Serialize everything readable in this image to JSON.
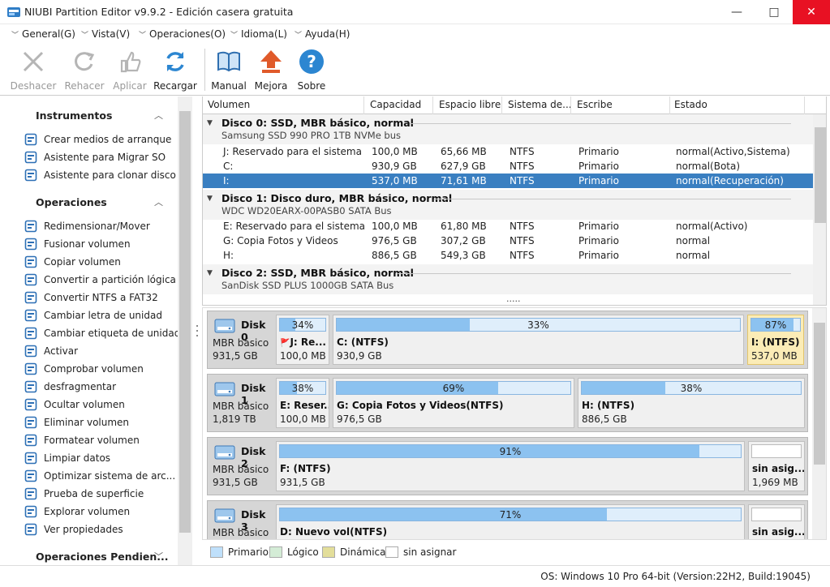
{
  "window": {
    "title": "NIUBI Partition Editor v9.9.2 - Edición casera gratuita",
    "minimize": "—",
    "maximize": "□",
    "close": "✕"
  },
  "menu": [
    {
      "label": "General(G)"
    },
    {
      "label": "Vista(V)"
    },
    {
      "label": "Operaciones(O)"
    },
    {
      "label": "Idioma(L)"
    },
    {
      "label": "Ayuda(H)"
    }
  ],
  "toolbar": {
    "undo": "Deshacer",
    "redo": "Rehacer",
    "apply": "Aplicar",
    "reload": "Recargar",
    "manual": "Manual",
    "upgrade": "Mejora",
    "about": "Sobre"
  },
  "sidebar": {
    "tools_title": "Instrumentos",
    "tools": [
      "Crear medios de arranque",
      "Asistente para Migrar SO",
      "Asistente para clonar disco"
    ],
    "ops_title": "Operaciones",
    "ops": [
      "Redimensionar/Mover",
      "Fusionar volumen",
      "Copiar volumen",
      "Convertir a partición lógica",
      "Convertir NTFS a FAT32",
      "Cambiar letra de unidad",
      "Cambiar etiqueta de unidad",
      "Activar",
      "Comprobar volumen",
      "desfragmentar",
      "Ocultar volumen",
      "Eliminar volumen",
      "Formatear volumen",
      "Limpiar datos",
      "Optimizar sistema de arc...",
      "Prueba de superficie",
      "Explorar volumen",
      "Ver propiedades"
    ],
    "pending_title": "Operaciones Pendien..."
  },
  "columns": [
    "Volumen",
    "Capacidad",
    "Espacio libre",
    "Sistema de...",
    "Escribe",
    "Estado"
  ],
  "disks": [
    {
      "title": "Disco 0: SSD, MBR básico, normal",
      "model": "Samsung SSD 990 PRO 1TB NVMe bus",
      "rows": [
        [
          "J: Reservado para el sistema",
          "100,0 MB",
          "65,66 MB",
          "NTFS",
          "Primario",
          "normal(Activo,Sistema)"
        ],
        [
          "C:",
          "930,9 GB",
          "627,9 GB",
          "NTFS",
          "Primario",
          "normal(Bota)"
        ],
        [
          "I:",
          "537,0 MB",
          "71,61 MB",
          "NTFS",
          "Primario",
          "normal(Recuperación)"
        ]
      ]
    },
    {
      "title": "Disco 1: Disco duro, MBR básico, normal",
      "model": "WDC WD20EARX-00PASB0 SATA Bus",
      "rows": [
        [
          "E: Reservado para el sistema",
          "100,0 MB",
          "61,80 MB",
          "NTFS",
          "Primario",
          "normal(Activo)"
        ],
        [
          "G: Copia Fotos y Videos",
          "976,5 GB",
          "307,2 GB",
          "NTFS",
          "Primario",
          "normal"
        ],
        [
          "H:",
          "886,5 GB",
          "549,3 GB",
          "NTFS",
          "Primario",
          "normal"
        ]
      ]
    },
    {
      "title": "Disco 2: SSD, MBR básico, normal",
      "model": "SanDisk SSD PLUS 1000GB SATA Bus"
    }
  ],
  "more_dots": ".....",
  "diskmap": [
    {
      "name": "Disk 0",
      "type": "MBR básico",
      "size": "931,5 GB",
      "parts": [
        {
          "pct": "34%",
          "fill": 0.34,
          "label": "J: Re...",
          "size": "100,0 MB",
          "flag": true
        },
        {
          "pct": "33%",
          "fill": 0.33,
          "label": "C: (NTFS)",
          "size": "930,9 GB"
        },
        {
          "pct": "87%",
          "fill": 0.87,
          "label": "I: (NTFS)",
          "size": "537,0 MB",
          "selected": true
        }
      ]
    },
    {
      "name": "Disk 1",
      "type": "MBR básico",
      "size": "1,819 TB",
      "parts": [
        {
          "pct": "38%",
          "fill": 0.38,
          "label": "E: Reser...",
          "size": "100,0 MB"
        },
        {
          "pct": "69%",
          "fill": 0.69,
          "label": "G: Copia Fotos y Videos(NTFS)",
          "size": "976,5 GB"
        },
        {
          "pct": "38%",
          "fill": 0.38,
          "label": "H: (NTFS)",
          "size": "886,5 GB"
        }
      ]
    },
    {
      "name": "Disk 2",
      "type": "MBR básico",
      "size": "931,5 GB",
      "parts": [
        {
          "pct": "91%",
          "fill": 0.91,
          "label": "F: (NTFS)",
          "size": "931,5 GB"
        },
        {
          "pct": "",
          "fill": 0,
          "label": "sin asig...",
          "size": "1,969 MB",
          "unalloc": true
        }
      ]
    },
    {
      "name": "Disk 3",
      "type": "MBR básico",
      "size": "",
      "parts": [
        {
          "pct": "71%",
          "fill": 0.71,
          "label": "D: Nuevo vol(NTFS)",
          "size": ""
        },
        {
          "pct": "",
          "fill": 0,
          "label": "sin asig...",
          "size": "",
          "unalloc": true
        }
      ]
    }
  ],
  "legend": [
    "Primario",
    "Lógico",
    "Dinámica",
    "sin asignar"
  ],
  "colors": {
    "selected_row": "#3a7fc1",
    "bar_fill": "#8cc2f0",
    "selected_part": "#fbecb6",
    "close": "#e81123"
  },
  "status": "OS: Windows 10 Pro 64-bit (Version:22H2, Build:19045)"
}
